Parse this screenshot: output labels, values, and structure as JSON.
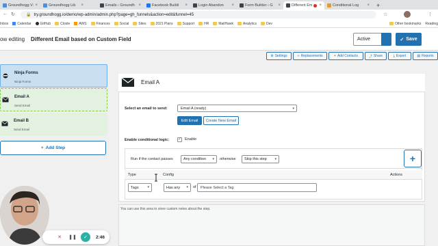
{
  "browser": {
    "tabs": [
      {
        "label": "Groundhogg V:",
        "color": "#4a90d9"
      },
      {
        "label": "Groundhogg Lib",
        "color": "#4a90d9"
      },
      {
        "label": "Emails ‹ Groundh",
        "color": "#3c434a"
      },
      {
        "label": "Facebook Buildi",
        "color": "#1877f2"
      },
      {
        "label": "Login Abandon",
        "color": "#3c434a"
      },
      {
        "label": "Form Builder ‹ G",
        "color": "#3c434a"
      },
      {
        "label": "Different Em",
        "color": "#3c434a"
      },
      {
        "label": "Conditional Log",
        "color": "#e59c2a"
      }
    ],
    "active_tab_index": 6,
    "url": "try.groundhogg.io/demo/wp-admin/admin.php?page=gh_funnels&action=edit&funnel=45",
    "bookmarks": [
      "Inbox",
      "Calendar",
      "GitHub",
      "Closte",
      "AWS",
      "Finances",
      "Social",
      "Sites",
      "2021 Plans",
      "Support",
      "HR",
      "MailHawk",
      "Analytics",
      "Dev"
    ],
    "other_bookmarks": "Other bookmarks",
    "reading_list": "Reading"
  },
  "header": {
    "title_prefix": "ow editing",
    "title": "Different Email based on Custom Field",
    "status": "Active",
    "save_label": "Save"
  },
  "toolbar": {
    "settings": "Settings",
    "replacements": "Replacements",
    "add_contacts": "Add Contacts",
    "share": "Share",
    "export": "Export",
    "reports": "Reports"
  },
  "steps": [
    {
      "title": "Ninja Forms",
      "subtitle": "Ninja Forms"
    },
    {
      "title": "Email A",
      "subtitle": "Send Email"
    },
    {
      "title": "Email B",
      "subtitle": "Send Email"
    }
  ],
  "add_step_label": "Add Step",
  "editor": {
    "title": "Email A",
    "select_email_label": "Select an email to send:",
    "selected_email": "Email A (ready)",
    "edit_email": "Edit Email",
    "create_email": "Create New Email",
    "conditional_label": "Enable conditional logic:",
    "enable_label": "Enable",
    "run_if": "Run if the contact passes",
    "condition_mode": "Any condition",
    "otherwise": "otherwise",
    "otherwise_action": "Skip this step",
    "col_type": "Type",
    "col_config": "Config",
    "col_actions": "Actions",
    "row_type": "Tags",
    "row_operator": "Has any",
    "row_of": "of",
    "tag_placeholder": "Please Select a Tag",
    "notes_placeholder": "You can use this area to store custom notes about the step."
  },
  "recorder": {
    "time": "2:46"
  }
}
